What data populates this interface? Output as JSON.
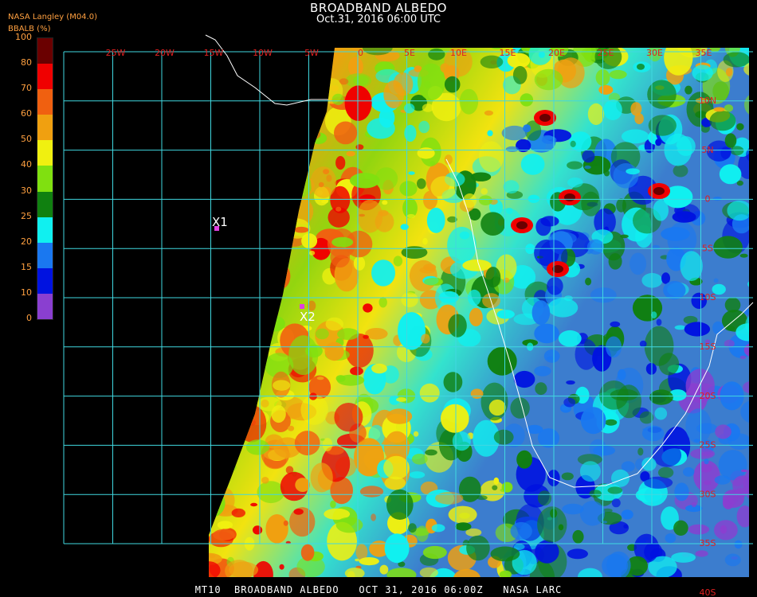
{
  "header": {
    "title": "BROADBAND ALBEDO",
    "subtitle": "Oct.31, 2016 06:00 UTC",
    "source": "NASA Langley (M04.0)",
    "colorbar_label": "BBALB (%)"
  },
  "colorbar": {
    "ticks": [
      "0",
      "10",
      "15",
      "20",
      "25",
      "30",
      "40",
      "50",
      "60",
      "70",
      "80",
      "100"
    ],
    "colors": [
      "#8a3fd0",
      "#0012e0",
      "#1a78f0",
      "#10f0f0",
      "#108010",
      "#80e010",
      "#f0f010",
      "#f0a010",
      "#f06010",
      "#f00000",
      "#6a0000"
    ]
  },
  "map": {
    "lon_labels": [
      "25W",
      "20W",
      "15W",
      "10W",
      "5W",
      "0",
      "5E",
      "10E",
      "15E",
      "20E",
      "25E",
      "30E",
      "35E"
    ],
    "lat_labels": [
      "10N",
      "5N",
      "0",
      "5S",
      "10S",
      "15S",
      "20S",
      "25S",
      "30S",
      "35S",
      "40S"
    ],
    "markers": [
      {
        "label": "X1",
        "color": "#e040e0"
      },
      {
        "label": "X2",
        "color": "#e040e0"
      }
    ],
    "grid_color": "#40d8e0",
    "label_color": "#e02020"
  },
  "footer": {
    "text": "MT10  BROADBAND ALBEDO   OCT 31, 2016 06:00Z   NASA LARC"
  }
}
